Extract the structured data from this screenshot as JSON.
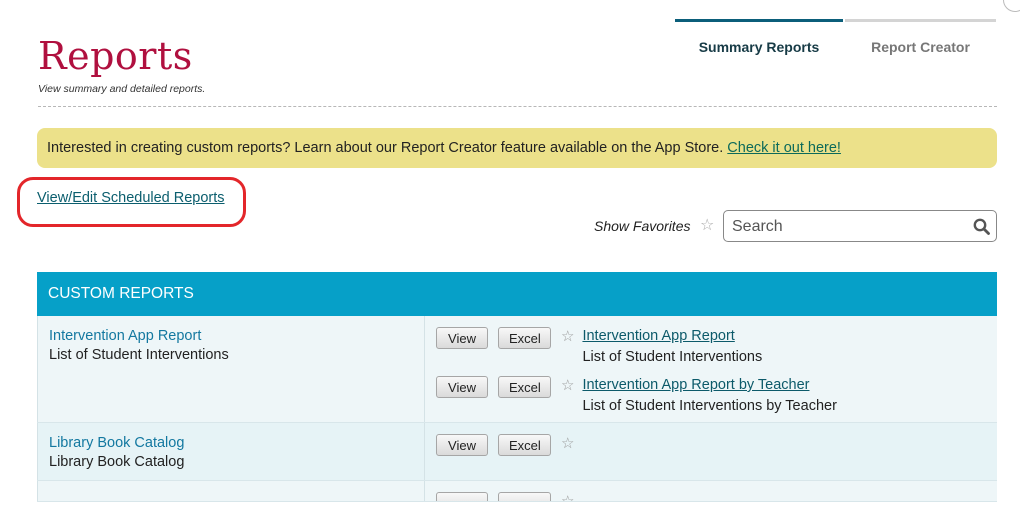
{
  "header": {
    "title": "Reports",
    "subtitle": "View summary and detailed reports."
  },
  "tabs": [
    {
      "label": "Summary Reports",
      "active": true
    },
    {
      "label": "Report Creator",
      "active": false
    }
  ],
  "banner": {
    "text": "Interested in creating custom reports? Learn about our Report Creator feature available on the App Store. ",
    "link_text": "Check it out here!"
  },
  "scheduled_link": "View/Edit Scheduled Reports",
  "filter": {
    "show_favorites_label": "Show Favorites",
    "search_placeholder": "Search"
  },
  "table": {
    "section_header": "CUSTOM REPORTS",
    "view_label": "View",
    "excel_label": "Excel",
    "rows": [
      {
        "name": "Intervention App Report",
        "description": "List of Student Interventions",
        "items": [
          {
            "title": "Intervention App Report",
            "description": "List of Student Interventions"
          },
          {
            "title": "Intervention App Report by Teacher",
            "description": "List of Student Interventions by Teacher"
          }
        ]
      },
      {
        "name": "Library Book Catalog",
        "description": "Library Book Catalog"
      }
    ]
  },
  "colors": {
    "brand": "#b0103f",
    "header_bar": "#06a0c8",
    "banner_bg": "#ece18a",
    "highlight": "#e3262a"
  },
  "icons": [
    "search-icon",
    "star-icon"
  ]
}
